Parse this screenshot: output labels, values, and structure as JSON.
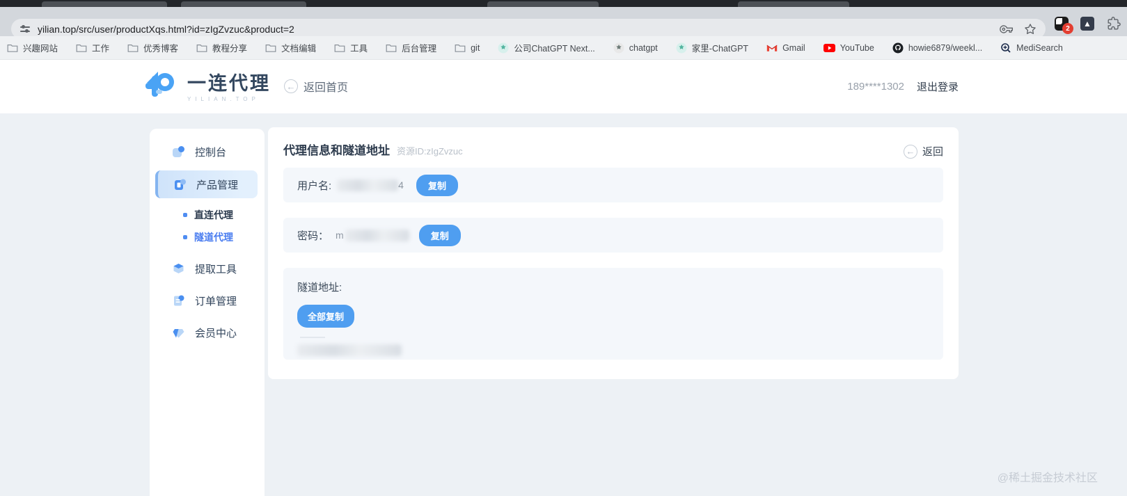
{
  "browser": {
    "url": "yilian.top/src/user/productXqs.html?id=zIgZvzuc&product=2",
    "extension_badge": "2",
    "bookmarks": [
      {
        "label": "兴趣网站"
      },
      {
        "label": "工作"
      },
      {
        "label": "优秀博客"
      },
      {
        "label": "教程分享"
      },
      {
        "label": "文档编辑"
      },
      {
        "label": "工具"
      },
      {
        "label": "后台管理"
      },
      {
        "label": "git"
      },
      {
        "label": "公司ChatGPT Next..."
      },
      {
        "label": "chatgpt"
      },
      {
        "label": "家里-ChatGPT"
      },
      {
        "label": "Gmail"
      },
      {
        "label": "YouTube"
      },
      {
        "label": "howie6879/weekl..."
      },
      {
        "label": "MediSearch"
      }
    ]
  },
  "header": {
    "logo_text": "一连代理",
    "logo_subtext": "YILIAN.TOP",
    "back_home_label": "返回首页",
    "phone_masked": "189****1302",
    "logout_label": "退出登录"
  },
  "sidebar": {
    "items": [
      {
        "label": "控制台"
      },
      {
        "label": "产品管理"
      },
      {
        "label": "提取工具"
      },
      {
        "label": "订单管理"
      },
      {
        "label": "会员中心"
      }
    ],
    "sub_items": [
      {
        "label": "直连代理"
      },
      {
        "label": "隧道代理"
      }
    ]
  },
  "main": {
    "title": "代理信息和隧道地址",
    "resource_id": "资源ID:zIgZvzuc",
    "back_label": "返回",
    "username": {
      "label": "用户名:",
      "value_fragment": "4",
      "copy_label": "复制"
    },
    "password": {
      "label": "密码：",
      "value_fragment": "m",
      "copy_label": "复制"
    },
    "tunnel": {
      "label": "隧道地址:",
      "copy_all_label": "全部复制"
    }
  },
  "watermark": "@稀土掘金技术社区",
  "colors": {
    "accent_blue": "#4f9ef0",
    "active_item_bg": "#d8e9fc",
    "active_link_blue": "#4a7df0",
    "badge_red": "#e33e31"
  }
}
